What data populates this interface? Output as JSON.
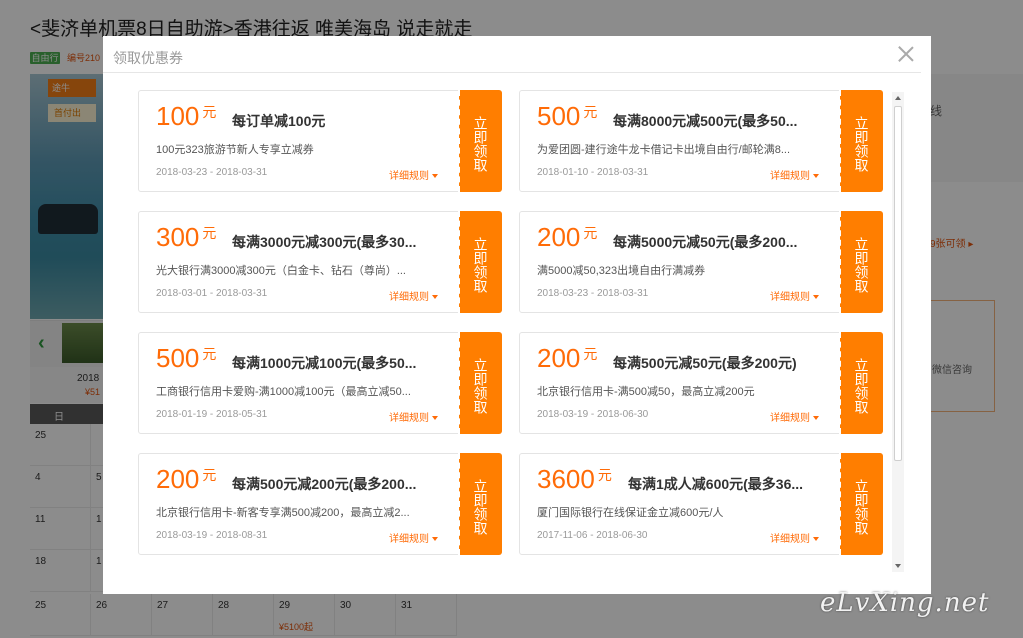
{
  "page": {
    "title": "<斐济单机票8日自助游>香港往返 唯美海岛 说走就走",
    "tag_type": "自由行",
    "tag_id": "编号210",
    "banner_logo": "途牛",
    "banner_sub": "首付出",
    "thumb_prev": "‹",
    "month_label": "2018",
    "month_price": "¥51",
    "weekday": "日",
    "right_text": "线",
    "right_coupon": "9张可领 ▸",
    "right_box_text": "微信咨询",
    "calendar": [
      {
        "day": "25",
        "price": ""
      },
      {
        "day": "",
        "price": ""
      },
      {
        "day": "4",
        "price": ""
      },
      {
        "day": "5",
        "price": ""
      },
      {
        "day": "11",
        "price": ""
      },
      {
        "day": "1",
        "price": ""
      },
      {
        "day": "18",
        "price": ""
      },
      {
        "day": "1",
        "price": ""
      },
      {
        "day": "25",
        "price": ""
      },
      {
        "day": "26",
        "price": ""
      },
      {
        "day": "27",
        "price": ""
      },
      {
        "day": "28",
        "price": ""
      },
      {
        "day": "29",
        "price": "¥5100起"
      },
      {
        "day": "30",
        "price": ""
      },
      {
        "day": "31",
        "price": ""
      }
    ]
  },
  "modal": {
    "title": "领取优惠券",
    "close_icon": "close-icon",
    "claim_label": "立即领取",
    "rules_label": "详细规则",
    "unit": "元",
    "coupons": [
      {
        "amount": "100",
        "name": "每订单减100元",
        "desc": "100元323旅游节新人专享立减券",
        "date": "2018-03-23 - 2018-03-31"
      },
      {
        "amount": "500",
        "name": "每满8000元减500元(最多50...",
        "desc": "为爱团圆-建行途牛龙卡借记卡出境自由行/邮轮满8...",
        "date": "2018-01-10 - 2018-03-31"
      },
      {
        "amount": "300",
        "name": "每满3000元减300元(最多30...",
        "desc": "光大银行满3000减300元（白金卡、钻石（尊尚）...",
        "date": "2018-03-01 - 2018-03-31"
      },
      {
        "amount": "200",
        "name": "每满5000元减50元(最多200...",
        "desc": "满5000减50,323出境自由行满减券",
        "date": "2018-03-23 - 2018-03-31"
      },
      {
        "amount": "500",
        "name": "每满1000元减100元(最多50...",
        "desc": "工商银行信用卡爱购-满1000减100元（最高立减50...",
        "date": "2018-01-19 - 2018-05-31"
      },
      {
        "amount": "200",
        "name": "每满500元减50元(最多200元)",
        "desc": "北京银行信用卡-满500减50，最高立减200元",
        "date": "2018-03-19 - 2018-06-30"
      },
      {
        "amount": "200",
        "name": "每满500元减200元(最多200...",
        "desc": "北京银行信用卡-新客专享满500减200，最高立减2...",
        "date": "2018-03-19 - 2018-08-31"
      },
      {
        "amount": "3600",
        "name": "每满1成人减600元(最多36...",
        "desc": "厦门国际银行在线保证金立减600元/人",
        "date": "2017-11-06 - 2018-06-30"
      }
    ]
  },
  "watermark": "eLvXing.net",
  "colors": {
    "accent": "#ff7e00",
    "amount": "#ff6b07",
    "overlay": "rgba(0,0,0,0.45)"
  }
}
